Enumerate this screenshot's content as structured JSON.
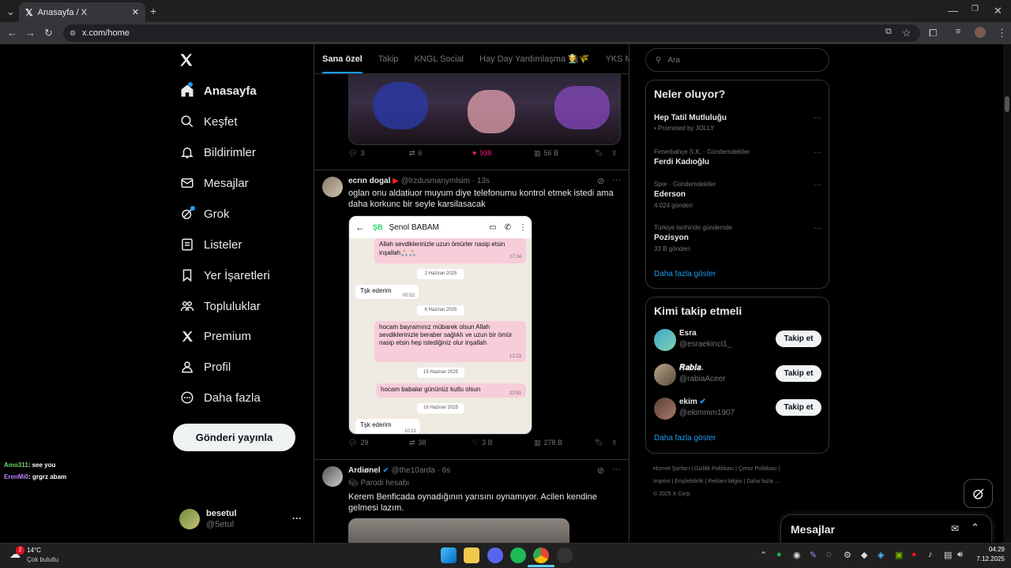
{
  "browser": {
    "tab_title": "Anasayfa / X",
    "url": "x.com/home"
  },
  "sidebar": {
    "items": [
      {
        "label": "Anasayfa",
        "icon": "home-icon"
      },
      {
        "label": "Keşfet",
        "icon": "search-icon"
      },
      {
        "label": "Bildirimler",
        "icon": "bell-icon"
      },
      {
        "label": "Mesajlar",
        "icon": "mail-icon"
      },
      {
        "label": "Grok",
        "icon": "grok-icon"
      },
      {
        "label": "Listeler",
        "icon": "list-icon"
      },
      {
        "label": "Yer İşaretleri",
        "icon": "bookmark-icon"
      },
      {
        "label": "Topluluklar",
        "icon": "communities-icon"
      },
      {
        "label": "Premium",
        "icon": "x-logo-icon"
      },
      {
        "label": "Profil",
        "icon": "profile-icon"
      },
      {
        "label": "Daha fazla",
        "icon": "more-circle-icon"
      }
    ],
    "post_button": "Gönderi yayınla",
    "account": {
      "name": "besetul",
      "handle": "@5etul"
    }
  },
  "chat_overlay": [
    {
      "user": "Amo311",
      "text": ": see you"
    },
    {
      "user": "ErenMi0",
      "text": ": grgrz abam"
    }
  ],
  "timeline_tabs": [
    "Sana özel",
    "Takip",
    "KNGL Social",
    "Hay Day Yardımlaşma 🧑‍🌾🌾",
    "YKS Man"
  ],
  "tweets": [
    {
      "actions": {
        "replies": "3",
        "reposts": "6",
        "likes": "938",
        "views": "56 B"
      }
    },
    {
      "name": "ecrın dogal",
      "handle": "@lrzdusmanymlsim",
      "time": "· 13s",
      "text": "oglan onu aldatiuor muyum diye telefonumu kontrol etmek istedi ama daha korkunc bir seyle karsilasacak",
      "chat": {
        "initials": "ŞB",
        "contact": "Şenol BABAM",
        "messages": [
          {
            "type": "out",
            "text": "Allah sevdiklerinizle uzun ömürler nasip etsin inşallah🙏🏻🙏🏻",
            "time": "17:14"
          },
          {
            "type": "date",
            "text": "2 Haziran 2025"
          },
          {
            "type": "in",
            "text": "Tşk ederim",
            "time": "00:52"
          },
          {
            "type": "date",
            "text": "6 Haziran 2025"
          },
          {
            "type": "out",
            "text": "hocam bayramınız mübarek olsun Allah sevdiklerinizle beraber sağlıklı ve uzun bir ömür nasip etsin hep istediğiniz olur inşallah",
            "time": "12:23"
          },
          {
            "type": "date",
            "text": "15 Haziran 2025"
          },
          {
            "type": "out",
            "text": "hocam babalar gününüz kutlu olsun",
            "time": "22:51"
          },
          {
            "type": "date",
            "text": "16 Haziran 2025"
          },
          {
            "type": "in",
            "text": "Tşk ederim",
            "time": "10:21"
          }
        ]
      },
      "actions": {
        "replies": "29",
        "reposts": "38",
        "likes": "3 B",
        "views": "278 B"
      }
    },
    {
      "name": "Ardiønel",
      "handle": "@the10arda",
      "time": "· 6s",
      "label": "Parodi hesabı",
      "text": "Kerem Benficada oynadığının yarısını oynamıyor. Acilen kendine gelmesi lazım."
    }
  ],
  "search": {
    "placeholder": "Ara"
  },
  "trends": {
    "title": "Neler oluyor?",
    "items": [
      {
        "context": "",
        "name": "Hep Tatil Mutluluğu",
        "count": "Promoted by JOLLY"
      },
      {
        "context": "Fenerbahçe S.K. · Gündemdekiler",
        "name": "Ferdi Kadıoğlu",
        "count": ""
      },
      {
        "context": "Spor · Gündemdekiler",
        "name": "Ederson",
        "count": "4.024 gönderi"
      },
      {
        "context": "Türkiye tarihinde gündemde",
        "name": "Pozisyon",
        "count": "33 B gönderi"
      }
    ],
    "show_more": "Daha fazla göster"
  },
  "who_to_follow": {
    "title": "Kimi takip etmeli",
    "items": [
      {
        "name": "Esra",
        "handle": "@esraekinci1_",
        "button": "Takip et"
      },
      {
        "name": "𝑹𝒂𝒃𝒊𝒂.",
        "handle": "@rabiaAceer",
        "button": "Takip et"
      },
      {
        "name": "ekim",
        "handle": "@ekimmm1907",
        "button": "Takip et"
      }
    ],
    "show_more": "Daha fazla göster"
  },
  "footer_links": [
    "Hizmet Şartları",
    "Gizlilik Politikası",
    "Çerez Politikası",
    "Imprint",
    "Erişilebilirlik",
    "Reklam bilgisi",
    "Daha fazla ...",
    "© 2025 X Corp."
  ],
  "messages_drawer": {
    "title": "Mesajlar"
  },
  "taskbar": {
    "weather_temp": "14°C",
    "weather_desc": "Çok bulutlu",
    "weather_badge": "2",
    "time": "04:29",
    "date": "7.12.2025"
  },
  "colors": {
    "accent": "#1d9bf0",
    "like": "#f91880",
    "bg": "#000000",
    "border": "#2f3336"
  }
}
